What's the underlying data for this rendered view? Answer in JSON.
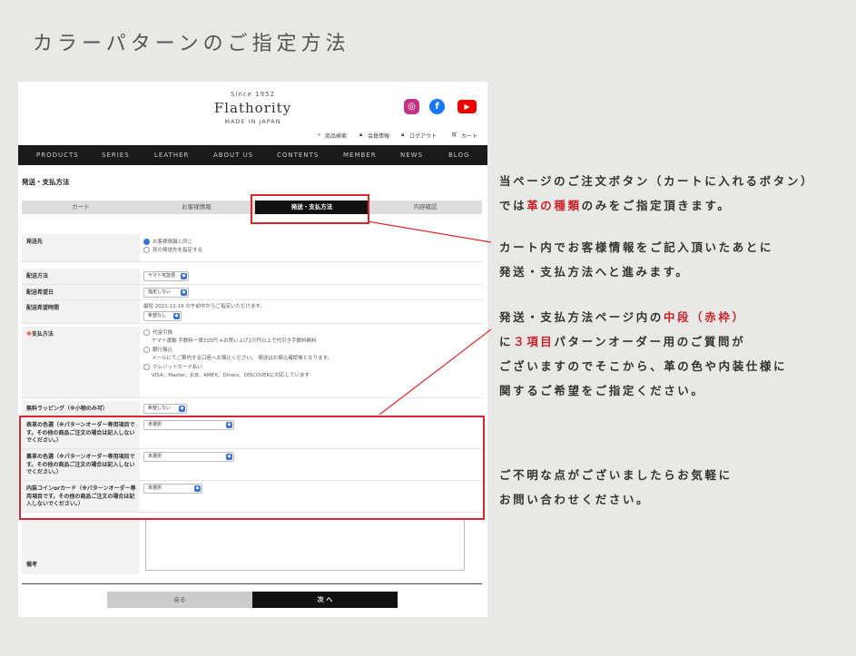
{
  "heading": "カラーパターンのご指定方法",
  "site": {
    "since": "Since 1952",
    "brand": "Flathority",
    "made_in": "MADE IN JAPAN",
    "sns": [
      "instagram-icon",
      "facebook-icon",
      "youtube-icon"
    ],
    "util_links": [
      "商品検索",
      "会員情報",
      "ログアウト",
      "カート"
    ],
    "gnav": [
      "PRODUCTS",
      "SERIES",
      "LEATHER",
      "ABOUT US",
      "CONTENTS",
      "MEMBER",
      "NEWS",
      "BLOG"
    ]
  },
  "page_title": "発送・支払方法",
  "steps": [
    "カート",
    "お客様情報",
    "発送・支払方法",
    "内容確認"
  ],
  "form": {
    "ship_to": {
      "label": "発送先",
      "opt1": "お客様情報と同じ",
      "opt2": "別の発送先を指定する"
    },
    "delivery_method": {
      "label": "配送方法",
      "value": "ヤマト宅急便"
    },
    "delivery_date": {
      "label": "配送希望日",
      "value": "指定しない"
    },
    "delivery_time": {
      "label": "配送希望時間",
      "note": "最短 2021-11-16 の午前中からご指定いただけます。",
      "value": "希望なし"
    },
    "payment": {
      "label": "支払方法",
      "required_mark": "※",
      "opt1": "代金引換",
      "opt1_note": "ヤマト運輸 手数料一律315円 ※お買い上げ2万円以上で代引き手数料無料",
      "opt2": "銀行振込",
      "opt2_note": "メールにてご案内する口座へお振込ください。 発送はお振込確認後となります。",
      "opt3": "クレジットカード払い",
      "opt3_note": "VISA、Master、JCB、AMEX、Diners、DISCOVERに対応しています"
    },
    "wrapping": {
      "label": "無料ラッピング（※小物のみ可）",
      "value": "希望しない"
    },
    "pattern_rows": [
      {
        "label": "表革の色選（※パターンオーダー専用項目です。その他の商品ご注文の場合は記入しないでください。）",
        "value": "未選択"
      },
      {
        "label": "裏革の色選（※パターンオーダー専用項目です。その他の商品ご注文の場合は記入しないでください。）",
        "value": "未選択"
      },
      {
        "label": "内装コインorカード（※パターンオーダー専用項目です。その他の商品ご注文の場合は記入しないでください。）",
        "value": "未選択"
      }
    ],
    "remarks": {
      "label": "備考"
    }
  },
  "buttons": {
    "back": "戻る",
    "next": "次 へ"
  },
  "notes": {
    "p1_l1_a": "当ページのご注文ボタン（カートに入れるボタン）",
    "p1_l2_a": "では",
    "p1_l2_red": "革の種類",
    "p1_l2_b": "のみをご指定頂きます。",
    "p2_l1": "カート内でお客様情報をご記入頂いたあとに",
    "p2_l2": "発送・支払方法へと進みます。",
    "p3_l1_a": "発送・支払方法ページ内の",
    "p3_l1_red": "中段（赤枠）",
    "p3_l2_a": "に",
    "p3_l2_red": "３項目",
    "p3_l2_b": "パターンオーダー用のご質問が",
    "p3_l3": "ございますのでそこから、革の色や内装仕様に",
    "p3_l4": "関するご希望をご指定ください。",
    "p4_l1": "ご不明な点がございましたらお気軽に",
    "p4_l2": "お問い合わせください。"
  },
  "colors": {
    "accent_red": "#d8262f",
    "nav_bg": "#1a1a1a"
  }
}
